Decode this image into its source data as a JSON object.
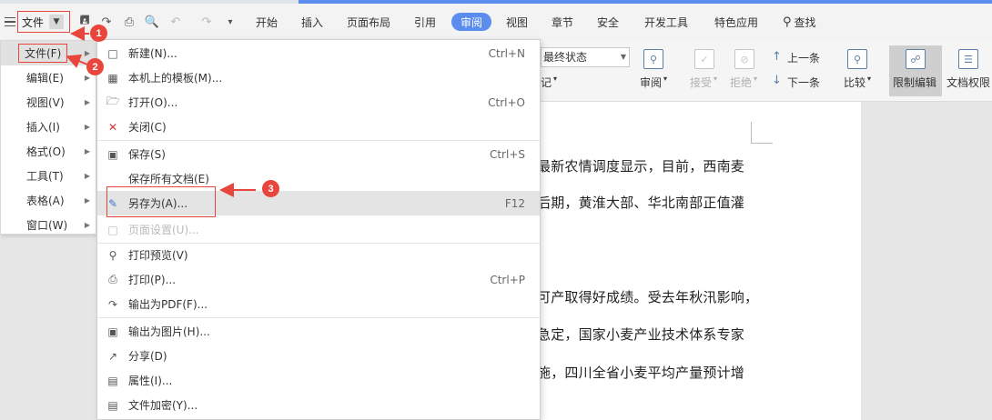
{
  "menubar": {
    "file_label": "文件",
    "tabs": [
      "开始",
      "插入",
      "页面布局",
      "引用",
      "审阅",
      "视图",
      "章节",
      "安全",
      "开发工具",
      "特色应用"
    ],
    "active_tab": "审阅",
    "search_label": "查找"
  },
  "ribbon": {
    "final_state": "最终状态",
    "final_state_sub": "记",
    "review_label": "审阅",
    "accept_label": "接受",
    "reject_label": "拒绝",
    "prev_label": "上一条",
    "next_label": "下一条",
    "compare_label": "比较",
    "restrict_label": "限制编辑",
    "doc_perm_label": "文档权限"
  },
  "left_menu": {
    "items": [
      {
        "label": "文件(F)"
      },
      {
        "label": "编辑(E)"
      },
      {
        "label": "视图(V)"
      },
      {
        "label": "插入(I)"
      },
      {
        "label": "格式(O)"
      },
      {
        "label": "工具(T)"
      },
      {
        "label": "表格(A)"
      },
      {
        "label": "窗口(W)"
      }
    ]
  },
  "file_menu": {
    "items": [
      {
        "label": "新建(N)...",
        "shortcut": "Ctrl+N",
        "icon": "new-doc-icon"
      },
      {
        "label": "本机上的模板(M)...",
        "shortcut": "",
        "icon": "template-icon"
      },
      {
        "label": "打开(O)...",
        "shortcut": "Ctrl+O",
        "icon": "folder-open-icon"
      },
      {
        "label": "关闭(C)",
        "shortcut": "",
        "icon": "close-doc-icon"
      },
      {
        "label": "保存(S)",
        "shortcut": "Ctrl+S",
        "icon": "save-icon"
      },
      {
        "label": "保存所有文档(E)",
        "shortcut": "",
        "icon": ""
      },
      {
        "label": "另存为(A)...",
        "shortcut": "F12",
        "icon": "save-as-icon"
      },
      {
        "label": "页面设置(U)...",
        "shortcut": "",
        "icon": "page-setup-icon"
      },
      {
        "label": "打印预览(V)",
        "shortcut": "",
        "icon": "print-preview-icon"
      },
      {
        "label": "打印(P)...",
        "shortcut": "Ctrl+P",
        "icon": "print-icon"
      },
      {
        "label": "输出为PDF(F)...",
        "shortcut": "",
        "icon": "pdf-icon"
      },
      {
        "label": "输出为图片(H)...",
        "shortcut": "",
        "icon": "image-export-icon"
      },
      {
        "label": "分享(D)",
        "shortcut": "",
        "icon": "share-icon"
      },
      {
        "label": "属性(I)...",
        "shortcut": "",
        "icon": "properties-icon"
      },
      {
        "label": "文件加密(Y)...",
        "shortcut": "",
        "icon": "encrypt-icon"
      }
    ]
  },
  "document": {
    "lines": [
      "最新农情调度显示，目前，西南麦",
      "后期，黄淮大部、华北南部正值灌",
      "可产取得好成绩。受去年秋汛影响，",
      "急定，国家小麦产业技术体系专家",
      "施，四川全省小麦平均产量预计增"
    ]
  },
  "annotations": {
    "badges": [
      "1",
      "2",
      "3"
    ],
    "color": "#e8453c"
  }
}
